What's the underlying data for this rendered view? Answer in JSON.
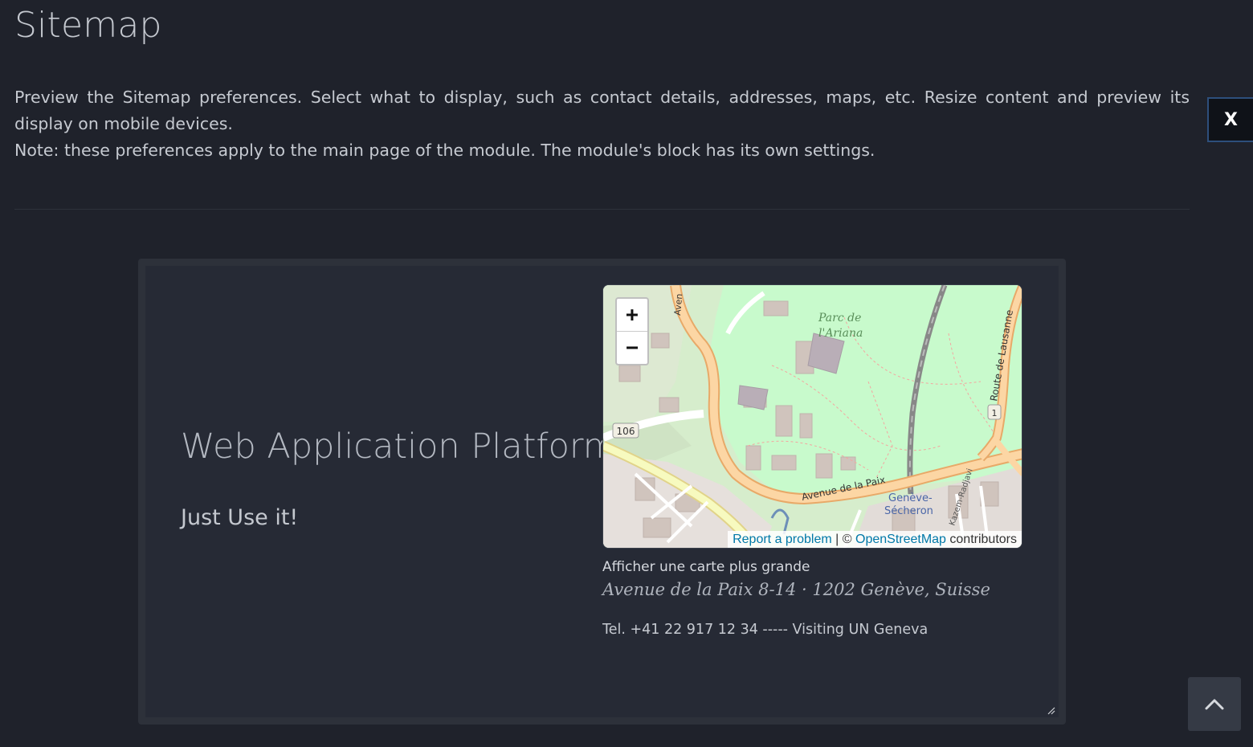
{
  "header": {
    "title": "Sitemap"
  },
  "intro": {
    "line1": "Preview the Sitemap preferences. Select what to display, such as contact details, addresses, maps, etc. Resize content and preview its display on mobile devices.",
    "line2": "Note: these preferences apply to the main page of the module. The module's block has its own settings."
  },
  "close_button": {
    "label": "X"
  },
  "preview": {
    "title": "Web Application Platform",
    "slogan": "Just Use it!",
    "map": {
      "zoom_in_label": "+",
      "zoom_out_label": "−",
      "labels": {
        "park": [
          "Parc de",
          "l'Ariana"
        ],
        "road": "Avenue de la Paix",
        "route": "Route de Lausanne",
        "station": [
          "Genève-",
          "Sécheron"
        ],
        "route_number": "106",
        "shield": "1",
        "avenue_short": "Aven",
        "kazem": "Kazem-Radjavi"
      },
      "attribution": {
        "report": "Report a problem",
        "separator": " | © ",
        "osm": "OpenStreetMap",
        "contributors": " contributors"
      }
    },
    "larger_map_link": "Afficher une carte plus grande",
    "address": "Avenue de la Paix 8-14 · 1202 Genève, Suisse",
    "contact": "Tel. +41 22 917 12 34 ----- Visiting UN Geneva"
  },
  "colors": {
    "background": "#1f222b",
    "panel": "#262a35",
    "frame": "#2d313a",
    "link": "#0078a8"
  }
}
